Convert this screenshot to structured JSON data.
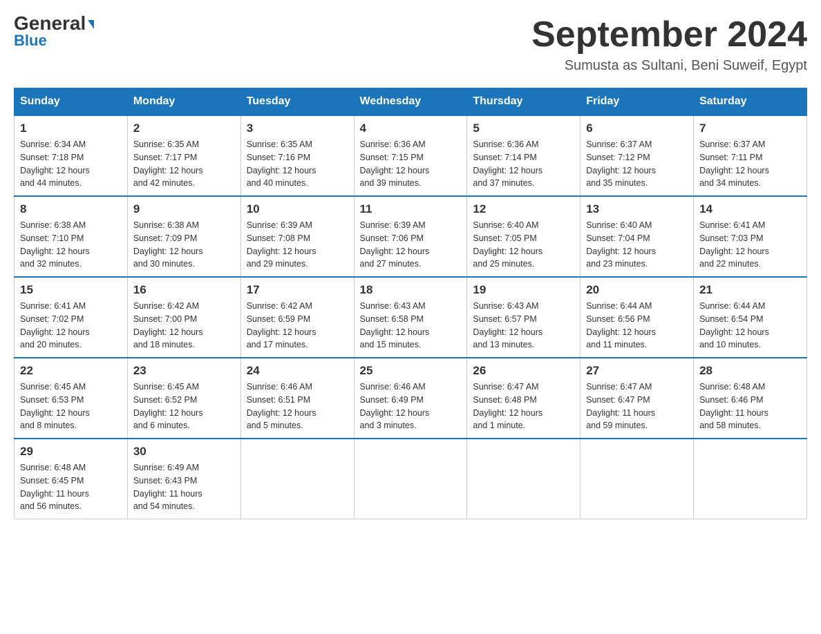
{
  "header": {
    "logo_general": "General",
    "logo_blue": "Blue",
    "month_title": "September 2024",
    "location": "Sumusta as Sultani, Beni Suweif, Egypt"
  },
  "weekdays": [
    "Sunday",
    "Monday",
    "Tuesday",
    "Wednesday",
    "Thursday",
    "Friday",
    "Saturday"
  ],
  "weeks": [
    [
      {
        "day": "1",
        "sunrise": "6:34 AM",
        "sunset": "7:18 PM",
        "daylight": "12 hours and 44 minutes."
      },
      {
        "day": "2",
        "sunrise": "6:35 AM",
        "sunset": "7:17 PM",
        "daylight": "12 hours and 42 minutes."
      },
      {
        "day": "3",
        "sunrise": "6:35 AM",
        "sunset": "7:16 PM",
        "daylight": "12 hours and 40 minutes."
      },
      {
        "day": "4",
        "sunrise": "6:36 AM",
        "sunset": "7:15 PM",
        "daylight": "12 hours and 39 minutes."
      },
      {
        "day": "5",
        "sunrise": "6:36 AM",
        "sunset": "7:14 PM",
        "daylight": "12 hours and 37 minutes."
      },
      {
        "day": "6",
        "sunrise": "6:37 AM",
        "sunset": "7:12 PM",
        "daylight": "12 hours and 35 minutes."
      },
      {
        "day": "7",
        "sunrise": "6:37 AM",
        "sunset": "7:11 PM",
        "daylight": "12 hours and 34 minutes."
      }
    ],
    [
      {
        "day": "8",
        "sunrise": "6:38 AM",
        "sunset": "7:10 PM",
        "daylight": "12 hours and 32 minutes."
      },
      {
        "day": "9",
        "sunrise": "6:38 AM",
        "sunset": "7:09 PM",
        "daylight": "12 hours and 30 minutes."
      },
      {
        "day": "10",
        "sunrise": "6:39 AM",
        "sunset": "7:08 PM",
        "daylight": "12 hours and 29 minutes."
      },
      {
        "day": "11",
        "sunrise": "6:39 AM",
        "sunset": "7:06 PM",
        "daylight": "12 hours and 27 minutes."
      },
      {
        "day": "12",
        "sunrise": "6:40 AM",
        "sunset": "7:05 PM",
        "daylight": "12 hours and 25 minutes."
      },
      {
        "day": "13",
        "sunrise": "6:40 AM",
        "sunset": "7:04 PM",
        "daylight": "12 hours and 23 minutes."
      },
      {
        "day": "14",
        "sunrise": "6:41 AM",
        "sunset": "7:03 PM",
        "daylight": "12 hours and 22 minutes."
      }
    ],
    [
      {
        "day": "15",
        "sunrise": "6:41 AM",
        "sunset": "7:02 PM",
        "daylight": "12 hours and 20 minutes."
      },
      {
        "day": "16",
        "sunrise": "6:42 AM",
        "sunset": "7:00 PM",
        "daylight": "12 hours and 18 minutes."
      },
      {
        "day": "17",
        "sunrise": "6:42 AM",
        "sunset": "6:59 PM",
        "daylight": "12 hours and 17 minutes."
      },
      {
        "day": "18",
        "sunrise": "6:43 AM",
        "sunset": "6:58 PM",
        "daylight": "12 hours and 15 minutes."
      },
      {
        "day": "19",
        "sunrise": "6:43 AM",
        "sunset": "6:57 PM",
        "daylight": "12 hours and 13 minutes."
      },
      {
        "day": "20",
        "sunrise": "6:44 AM",
        "sunset": "6:56 PM",
        "daylight": "12 hours and 11 minutes."
      },
      {
        "day": "21",
        "sunrise": "6:44 AM",
        "sunset": "6:54 PM",
        "daylight": "12 hours and 10 minutes."
      }
    ],
    [
      {
        "day": "22",
        "sunrise": "6:45 AM",
        "sunset": "6:53 PM",
        "daylight": "12 hours and 8 minutes."
      },
      {
        "day": "23",
        "sunrise": "6:45 AM",
        "sunset": "6:52 PM",
        "daylight": "12 hours and 6 minutes."
      },
      {
        "day": "24",
        "sunrise": "6:46 AM",
        "sunset": "6:51 PM",
        "daylight": "12 hours and 5 minutes."
      },
      {
        "day": "25",
        "sunrise": "6:46 AM",
        "sunset": "6:49 PM",
        "daylight": "12 hours and 3 minutes."
      },
      {
        "day": "26",
        "sunrise": "6:47 AM",
        "sunset": "6:48 PM",
        "daylight": "12 hours and 1 minute."
      },
      {
        "day": "27",
        "sunrise": "6:47 AM",
        "sunset": "6:47 PM",
        "daylight": "11 hours and 59 minutes."
      },
      {
        "day": "28",
        "sunrise": "6:48 AM",
        "sunset": "6:46 PM",
        "daylight": "11 hours and 58 minutes."
      }
    ],
    [
      {
        "day": "29",
        "sunrise": "6:48 AM",
        "sunset": "6:45 PM",
        "daylight": "11 hours and 56 minutes."
      },
      {
        "day": "30",
        "sunrise": "6:49 AM",
        "sunset": "6:43 PM",
        "daylight": "11 hours and 54 minutes."
      },
      null,
      null,
      null,
      null,
      null
    ]
  ],
  "labels": {
    "sunrise": "Sunrise:",
    "sunset": "Sunset:",
    "daylight": "Daylight:"
  }
}
